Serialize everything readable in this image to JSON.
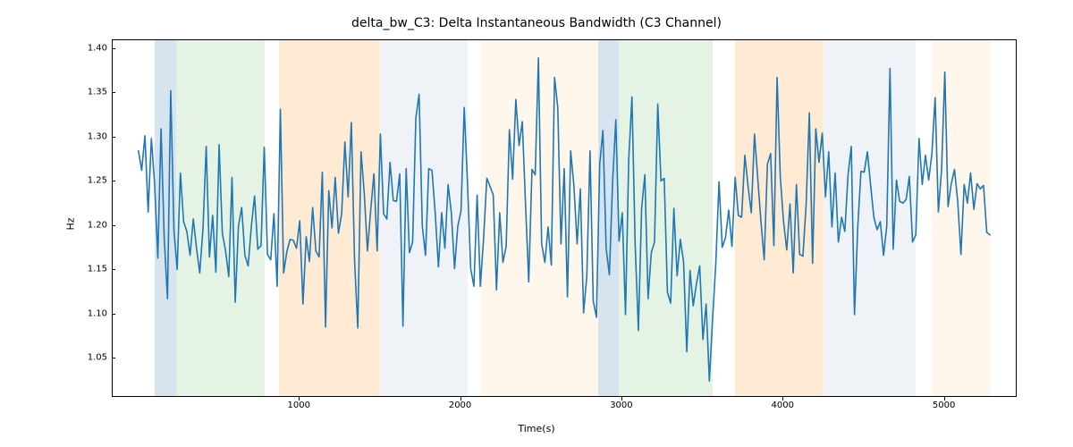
{
  "chart_data": {
    "type": "line",
    "title": "delta_bw_C3: Delta Instantaneous Bandwidth (C3 Channel)",
    "xlabel": "Time(s)",
    "ylabel": "Hz",
    "xlim": [
      -160,
      5440
    ],
    "ylim": [
      1.008,
      1.41
    ],
    "xticks": [
      1000,
      2000,
      3000,
      4000,
      5000
    ],
    "yticks": [
      1.05,
      1.1,
      1.15,
      1.2,
      1.25,
      1.3,
      1.35,
      1.4
    ],
    "regions": [
      {
        "x0": 100,
        "x1": 235,
        "color": "#7ba7cc"
      },
      {
        "x0": 235,
        "x1": 780,
        "color": "#a8d8a8"
      },
      {
        "x0": 780,
        "x1": 870,
        "color": "#ffffff"
      },
      {
        "x0": 870,
        "x1": 1500,
        "color": "#ffb870"
      },
      {
        "x0": 1500,
        "x1": 2040,
        "color": "#c9d8e8"
      },
      {
        "x0": 2040,
        "x1": 2120,
        "color": "#ffffff"
      },
      {
        "x0": 2120,
        "x1": 2850,
        "color": "#ffe1bf"
      },
      {
        "x0": 2850,
        "x1": 2980,
        "color": "#7ba7cc"
      },
      {
        "x0": 2980,
        "x1": 3560,
        "color": "#a8d8a8"
      },
      {
        "x0": 3560,
        "x1": 3700,
        "color": "#ffffff"
      },
      {
        "x0": 3700,
        "x1": 4250,
        "color": "#ffb870"
      },
      {
        "x0": 4250,
        "x1": 4820,
        "color": "#c9d8e8"
      },
      {
        "x0": 4820,
        "x1": 4920,
        "color": "#ffffff"
      },
      {
        "x0": 4920,
        "x1": 5280,
        "color": "#ffe1bf"
      }
    ],
    "x": [
      0,
      20,
      40,
      60,
      80,
      100,
      120,
      140,
      160,
      180,
      200,
      220,
      240,
      260,
      280,
      300,
      320,
      340,
      360,
      380,
      400,
      420,
      440,
      460,
      480,
      500,
      520,
      540,
      560,
      580,
      600,
      620,
      640,
      660,
      680,
      700,
      720,
      740,
      760,
      780,
      800,
      820,
      840,
      860,
      880,
      900,
      920,
      940,
      960,
      980,
      1000,
      1020,
      1040,
      1060,
      1080,
      1100,
      1120,
      1140,
      1160,
      1180,
      1200,
      1220,
      1240,
      1260,
      1280,
      1300,
      1320,
      1340,
      1360,
      1380,
      1400,
      1420,
      1440,
      1460,
      1480,
      1500,
      1520,
      1540,
      1560,
      1580,
      1600,
      1620,
      1640,
      1660,
      1680,
      1700,
      1720,
      1740,
      1760,
      1780,
      1800,
      1820,
      1840,
      1860,
      1880,
      1900,
      1920,
      1940,
      1960,
      1980,
      2000,
      2020,
      2040,
      2060,
      2080,
      2100,
      2120,
      2140,
      2160,
      2180,
      2200,
      2220,
      2240,
      2260,
      2280,
      2300,
      2320,
      2340,
      2360,
      2380,
      2400,
      2420,
      2440,
      2460,
      2480,
      2500,
      2520,
      2540,
      2560,
      2580,
      2600,
      2620,
      2640,
      2660,
      2680,
      2700,
      2720,
      2740,
      2760,
      2780,
      2800,
      2820,
      2840,
      2860,
      2880,
      2900,
      2920,
      2940,
      2960,
      2980,
      3000,
      3020,
      3040,
      3060,
      3080,
      3100,
      3120,
      3140,
      3160,
      3180,
      3200,
      3220,
      3240,
      3260,
      3280,
      3300,
      3320,
      3340,
      3360,
      3380,
      3400,
      3420,
      3440,
      3460,
      3480,
      3500,
      3520,
      3540,
      3560,
      3580,
      3600,
      3620,
      3640,
      3660,
      3680,
      3700,
      3720,
      3740,
      3760,
      3780,
      3800,
      3820,
      3840,
      3860,
      3880,
      3900,
      3920,
      3940,
      3960,
      3980,
      4000,
      4020,
      4040,
      4060,
      4080,
      4100,
      4120,
      4140,
      4160,
      4180,
      4200,
      4220,
      4240,
      4260,
      4280,
      4300,
      4320,
      4340,
      4360,
      4380,
      4400,
      4420,
      4440,
      4460,
      4480,
      4500,
      4520,
      4540,
      4560,
      4580,
      4600,
      4620,
      4640,
      4660,
      4680,
      4700,
      4720,
      4740,
      4760,
      4780,
      4800,
      4820,
      4840,
      4860,
      4880,
      4900,
      4920,
      4940,
      4960,
      4980,
      5000,
      5020,
      5040,
      5060,
      5080,
      5100,
      5120,
      5140,
      5160,
      5180,
      5200,
      5220,
      5240,
      5260,
      5280
    ],
    "y": [
      1.285,
      1.263,
      1.302,
      1.216,
      1.299,
      1.248,
      1.164,
      1.31,
      1.185,
      1.118,
      1.353,
      1.195,
      1.151,
      1.26,
      1.205,
      1.194,
      1.167,
      1.208,
      1.175,
      1.147,
      1.197,
      1.29,
      1.165,
      1.212,
      1.148,
      1.292,
      1.192,
      1.172,
      1.143,
      1.255,
      1.114,
      1.2,
      1.221,
      1.167,
      1.155,
      1.2,
      1.234,
      1.174,
      1.178,
      1.289,
      1.168,
      1.162,
      1.214,
      1.132,
      1.332,
      1.147,
      1.171,
      1.185,
      1.184,
      1.175,
      1.206,
      1.112,
      1.188,
      1.16,
      1.221,
      1.172,
      1.165,
      1.261,
      1.086,
      1.24,
      1.198,
      1.255,
      1.192,
      1.214,
      1.295,
      1.233,
      1.317,
      1.161,
      1.085,
      1.284,
      1.237,
      1.172,
      1.218,
      1.259,
      1.172,
      1.304,
      1.214,
      1.208,
      1.272,
      1.229,
      1.228,
      1.259,
      1.087,
      1.265,
      1.17,
      1.182,
      1.322,
      1.349,
      1.2,
      1.167,
      1.265,
      1.263,
      1.215,
      1.154,
      1.215,
      1.175,
      1.247,
      1.215,
      1.152,
      1.2,
      1.217,
      1.334,
      1.25,
      1.152,
      1.132,
      1.235,
      1.132,
      1.186,
      1.254,
      1.245,
      1.235,
      1.128,
      1.215,
      1.159,
      1.177,
      1.309,
      1.253,
      1.343,
      1.291,
      1.318,
      1.225,
      1.137,
      1.264,
      1.258,
      1.39,
      1.18,
      1.159,
      1.199,
      1.156,
      1.368,
      1.334,
      1.18,
      1.265,
      1.12,
      1.285,
      1.246,
      1.18,
      1.242,
      1.102,
      1.143,
      1.285,
      1.115,
      1.097,
      1.27,
      1.308,
      1.175,
      1.145,
      1.25,
      1.32,
      1.183,
      1.215,
      1.1,
      1.275,
      1.346,
      1.178,
      1.082,
      1.22,
      1.258,
      1.118,
      1.17,
      1.182,
      1.338,
      1.251,
      1.254,
      1.125,
      1.113,
      1.22,
      1.144,
      1.185,
      1.16,
      1.058,
      1.15,
      1.11,
      1.135,
      1.155,
      1.072,
      1.112,
      1.025,
      1.095,
      1.158,
      1.25,
      1.176,
      1.187,
      1.218,
      1.177,
      1.255,
      1.212,
      1.21,
      1.28,
      1.245,
      1.215,
      1.304,
      1.254,
      1.205,
      1.162,
      1.27,
      1.282,
      1.178,
      1.368,
      1.255,
      1.205,
      1.173,
      1.225,
      1.147,
      1.247,
      1.168,
      1.166,
      1.224,
      1.328,
      1.158,
      1.31,
      1.272,
      1.305,
      1.233,
      1.284,
      1.199,
      1.26,
      1.182,
      1.21,
      1.194,
      1.258,
      1.29,
      1.1,
      1.198,
      1.262,
      1.261,
      1.284,
      1.246,
      1.21,
      1.196,
      1.205,
      1.167,
      1.2,
      1.378,
      1.174,
      1.252,
      1.228,
      1.226,
      1.23,
      1.256,
      1.182,
      1.19,
      1.299,
      1.247,
      1.28,
      1.252,
      1.282,
      1.345,
      1.216,
      1.264,
      1.374,
      1.222,
      1.248,
      1.264,
      1.228,
      1.168,
      1.247,
      1.226,
      1.26,
      1.219,
      1.248,
      1.242,
      1.246,
      1.193,
      1.19
    ]
  }
}
